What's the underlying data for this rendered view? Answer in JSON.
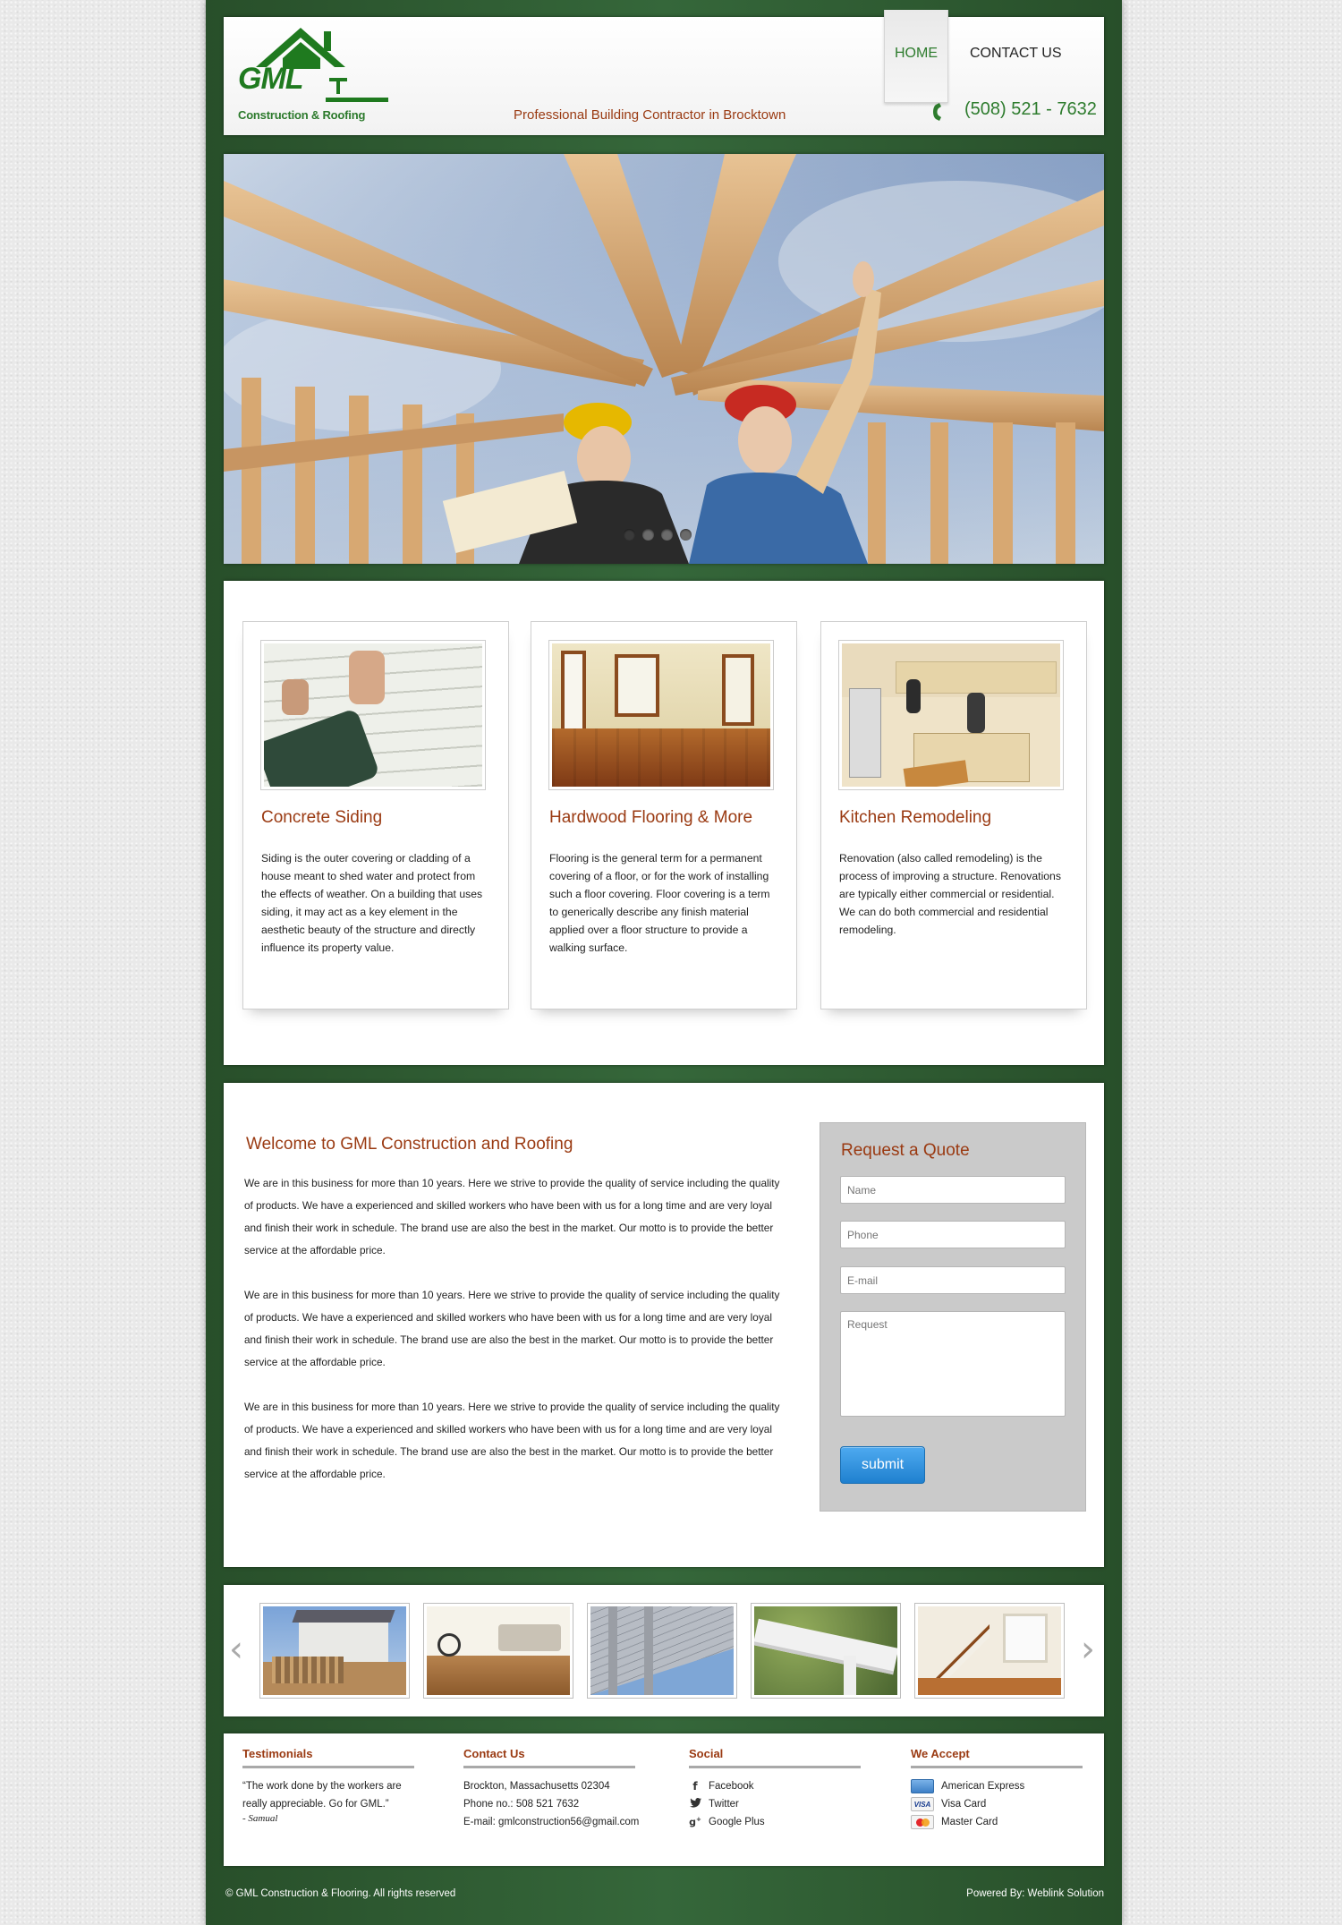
{
  "header": {
    "logo_name": "GML",
    "logo_sub": "Construction & Roofing",
    "tagline": "Professional Building Contractor in Brocktown",
    "phone": "(508) 521 - 7632",
    "nav": [
      {
        "label": "HOME",
        "active": true
      },
      {
        "label": "CONTACT US",
        "active": false
      }
    ],
    "brand_green": "#2e7c2e",
    "accent_rust": "#9a3a12"
  },
  "hero": {
    "slides_total": 4,
    "active_slide": 1
  },
  "services": [
    {
      "title": "Concrete Siding",
      "text": "Siding is the outer covering or cladding of a house meant to shed water and protect from the effects of weather. On a building that uses siding, it may act as a key element in the aesthetic beauty of the structure and directly influence its property value."
    },
    {
      "title": "Hardwood Flooring & More",
      "text": "Flooring is the general term for a permanent covering of a floor, or for the work of installing such a floor covering. Floor covering is a term to generically describe any finish material applied over a floor structure to provide a walking surface."
    },
    {
      "title": "Kitchen Remodeling",
      "text": "Renovation (also called remodeling) is the process of improving a structure. Renovations are typically either commercial or residential. We can do both commercial and residential remodeling."
    }
  ],
  "welcome": {
    "title": "Welcome to GML Construction and Roofing",
    "paragraphs": [
      "We are in this business for more than 10 years. Here we strive to provide the quality of service including the quality of products. We have a experienced and skilled workers who have been with us for a long time and are very loyal and finish their work in schedule. The brand use are also the best in the market. Our motto is to provide the better service at the affordable price.",
      "We are in this business for more than 10 years. Here we strive to provide the quality of service including the quality of products. We have a experienced and skilled workers who have been with us for a long time and are very loyal and finish their work in schedule. The brand use are also the best in the market. Our motto is to provide the better service at the affordable price.",
      "We are in this business for more than 10 years. Here we strive to provide the quality of service including the quality of products. We have a experienced and skilled workers who have been with us for a long time and are very loyal and finish their work in schedule. The brand use are also the best in the market. Our motto is to provide the better service at the affordable price."
    ]
  },
  "quote": {
    "title": "Request a Quote",
    "name_placeholder": "Name",
    "phone_placeholder": "Phone",
    "email_placeholder": "E-mail",
    "request_placeholder": "Request",
    "submit_label": "submit"
  },
  "gallery": {
    "prev_icon": "chevron-left-icon",
    "next_icon": "chevron-right-icon",
    "prev_glyph": "‹",
    "next_glyph": "›"
  },
  "footer": {
    "testimonials": {
      "heading": "Testimonials",
      "quote_line1": "“The work done by the workers are",
      "quote_line2": "really appreciable. Go for GML.”",
      "author": "- Samual"
    },
    "contact": {
      "heading": "Contact Us",
      "address": "Brockton, Massachusetts 02304",
      "phone": "Phone no.: 508 521 7632",
      "email": "E-mail: gmlconstruction56@gmail.com"
    },
    "social": {
      "heading": "Social",
      "items": [
        {
          "label": "Facebook",
          "icon": "facebook-icon"
        },
        {
          "label": "Twitter",
          "icon": "twitter-icon"
        },
        {
          "label": "Google Plus",
          "icon": "google-plus-icon"
        }
      ]
    },
    "accept": {
      "heading": "We Accept",
      "items": [
        {
          "label": "American Express",
          "icon": "amex-card-icon"
        },
        {
          "label": "Visa Card",
          "icon": "visa-card-icon"
        },
        {
          "label": "Master Card",
          "icon": "mastercard-icon"
        }
      ]
    }
  },
  "bottom": {
    "copyright": "© GML Construction & Flooring. All rights reserved",
    "powered_by": "Powered By: Weblink Solution"
  }
}
